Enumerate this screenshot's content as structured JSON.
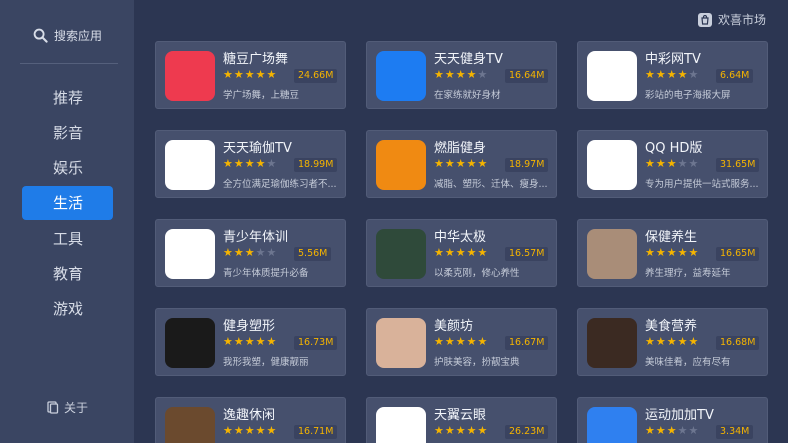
{
  "header": {
    "market_label": "欢喜市场"
  },
  "sidebar": {
    "search_label": "搜索应用",
    "nav": [
      "推荐",
      "影音",
      "娱乐",
      "生活",
      "工具",
      "教育",
      "游戏"
    ],
    "active_index": 3,
    "about_label": "关于"
  },
  "apps": [
    {
      "name": "糖豆广场舞",
      "rating": 4.5,
      "size": "24.66M",
      "desc": "学广场舞，上糖豆",
      "icon": "tangdou-icon",
      "color": "#ee3a4f"
    },
    {
      "name": "天天健身TV",
      "rating": 3.5,
      "size": "16.64M",
      "desc": "在家练就好身材",
      "icon": "fitness-icon",
      "color": "#1d7cf2"
    },
    {
      "name": "中彩网TV",
      "rating": 3.5,
      "size": "6.64M",
      "desc": "彩站的电子海报大屏",
      "icon": "lottery-tv-icon",
      "color": "#ffffff"
    },
    {
      "name": "天天瑜伽TV",
      "rating": 4,
      "size": "18.99M",
      "desc": "全方位满足瑜伽练习者不...",
      "icon": "yoga-icon",
      "color": "#ffffff"
    },
    {
      "name": "燃脂健身",
      "rating": 4.5,
      "size": "18.97M",
      "desc": "减脂、塑形、迁体、瘦身...",
      "icon": "fat-burn-icon",
      "color": "#f08a12"
    },
    {
      "name": "QQ HD版",
      "rating": 3,
      "size": "31.65M",
      "desc": "专为用户提供一站式服务...",
      "icon": "qq-icon",
      "color": "#ffffff"
    },
    {
      "name": "青少年体训",
      "rating": 3,
      "size": "5.56M",
      "desc": "青少年体质提升必备",
      "icon": "youth-training-icon",
      "color": "#ffffff"
    },
    {
      "name": "中华太极",
      "rating": 4.5,
      "size": "16.57M",
      "desc": "以柔克刚，修心养性",
      "icon": "taichi-icon",
      "color": "#2f4a3a"
    },
    {
      "name": "保健养生",
      "rating": 4.5,
      "size": "16.65M",
      "desc": "养生理疗，益寿延年",
      "icon": "wellness-icon",
      "color": "#a98d78"
    },
    {
      "name": "健身塑形",
      "rating": 4.5,
      "size": "16.73M",
      "desc": "我形我塑，健康靓丽",
      "icon": "body-shaping-icon",
      "color": "#1a1a1a"
    },
    {
      "name": "美颜坊",
      "rating": 4.5,
      "size": "16.67M",
      "desc": "护肤美容，扮靓宝典",
      "icon": "beauty-icon",
      "color": "#d9b29a"
    },
    {
      "name": "美食营养",
      "rating": 4.5,
      "size": "16.68M",
      "desc": "美味佳肴，应有尽有",
      "icon": "food-icon",
      "color": "#3b2a22"
    },
    {
      "name": "逸趣休闲",
      "rating": 4.5,
      "size": "16.71M",
      "desc": "",
      "icon": "leisure-icon",
      "color": "#6b4a2e"
    },
    {
      "name": "天翼云眼",
      "rating": 4.5,
      "size": "26.23M",
      "desc": "",
      "icon": "cloud-eye-icon",
      "color": "#ffffff"
    },
    {
      "name": "运动加加TV",
      "rating": 3,
      "size": "3.34M",
      "desc": "",
      "icon": "sports-plus-icon",
      "color": "#2f80f0"
    }
  ]
}
